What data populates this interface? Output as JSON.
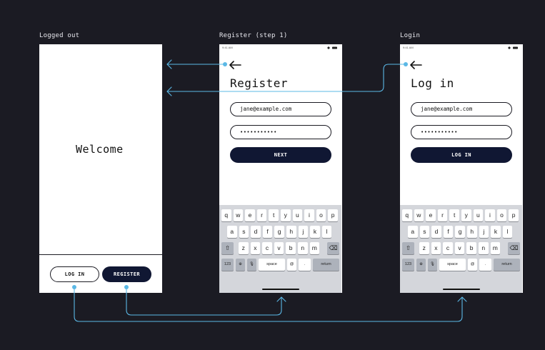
{
  "frames": {
    "logged_out": {
      "label": "Logged out",
      "welcome": "Welcome",
      "login_button": "LOG IN",
      "register_button": "REGISTER"
    },
    "register": {
      "label": "Register (step 1)",
      "status_time": "9:41 AM",
      "back_icon": "arrow-left-icon",
      "title": "Register",
      "email_value": "jane@example.com",
      "password_value": "•••••••••••",
      "primary_button": "NEXT"
    },
    "login": {
      "label": "Login",
      "status_time": "9:41 AM",
      "back_icon": "arrow-left-icon",
      "title": "Log in",
      "email_value": "jane@example.com",
      "password_value": "•••••••••••",
      "primary_button": "LOG IN"
    }
  },
  "keyboard": {
    "row1": [
      "q",
      "w",
      "e",
      "r",
      "t",
      "y",
      "u",
      "i",
      "o",
      "p"
    ],
    "row2": [
      "a",
      "s",
      "d",
      "f",
      "g",
      "h",
      "j",
      "k",
      "l"
    ],
    "row3": [
      "z",
      "x",
      "c",
      "v",
      "b",
      "n",
      "m"
    ],
    "shift_icon": "shift-icon",
    "delete_icon": "delete-icon",
    "numbers": "123",
    "globe_icon": "globe-icon",
    "mic_icon": "microphone-icon",
    "space": "space",
    "at": "@",
    "period": ".",
    "return": "return"
  },
  "colors": {
    "canvas": "#1b1b23",
    "screen": "#ffffff",
    "primary": "#101733",
    "flow_line": "#5bb8e6",
    "keyboard_bg": "#d4d6db"
  }
}
